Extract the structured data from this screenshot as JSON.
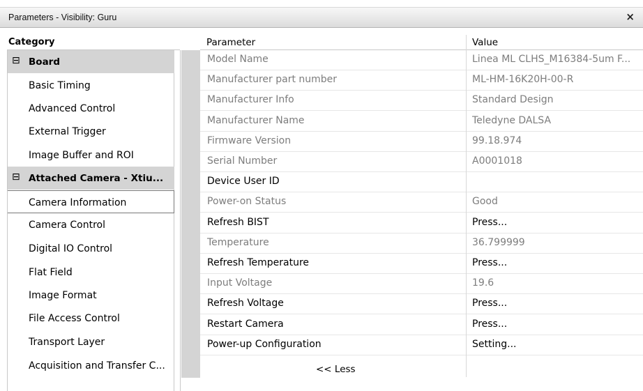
{
  "window": {
    "title": "Parameters - Visibility: Guru",
    "close_glyph": "×"
  },
  "headers": {
    "category": "Category",
    "parameter": "Parameter",
    "value": "Value"
  },
  "categories": [
    {
      "type": "group",
      "glyph": "⊟",
      "label": "Board"
    },
    {
      "type": "item",
      "label": "Basic Timing"
    },
    {
      "type": "item",
      "label": "Advanced Control"
    },
    {
      "type": "item",
      "label": "External Trigger"
    },
    {
      "type": "item",
      "label": "Image Buffer and ROI"
    },
    {
      "type": "group",
      "glyph": "⊟",
      "label": "Attached Camera - Xtiu..."
    },
    {
      "type": "item",
      "label": "Camera Information",
      "selected": true
    },
    {
      "type": "item",
      "label": "Camera Control"
    },
    {
      "type": "item",
      "label": "Digital IO Control"
    },
    {
      "type": "item",
      "label": "Flat Field"
    },
    {
      "type": "item",
      "label": "Image Format"
    },
    {
      "type": "item",
      "label": "File Access Control"
    },
    {
      "type": "item",
      "label": "Transport Layer"
    },
    {
      "type": "item",
      "label": "Acquisition and Transfer C..."
    }
  ],
  "parameters": [
    {
      "name": "Model Name",
      "value": "Linea ML CLHS_M16384-5um F...",
      "readonly": true
    },
    {
      "name": "Manufacturer part number",
      "value": "ML-HM-16K20H-00-R",
      "readonly": true
    },
    {
      "name": "Manufacturer Info",
      "value": "Standard Design",
      "readonly": true
    },
    {
      "name": "Manufacturer Name",
      "value": "Teledyne DALSA",
      "readonly": true
    },
    {
      "name": "Firmware Version",
      "value": "99.18.974",
      "readonly": true
    },
    {
      "name": "Serial Number",
      "value": "A0001018",
      "readonly": true
    },
    {
      "name": "Device User ID",
      "value": "",
      "readonly": false
    },
    {
      "name": "Power-on Status",
      "value": "Good",
      "readonly": true
    },
    {
      "name": "Refresh BIST",
      "value": "Press...",
      "readonly": false
    },
    {
      "name": "Temperature",
      "value": "36.799999",
      "readonly": true
    },
    {
      "name": "Refresh Temperature",
      "value": "Press...",
      "readonly": false
    },
    {
      "name": "Input Voltage",
      "value": "19.6",
      "readonly": true
    },
    {
      "name": "Refresh Voltage",
      "value": "Press...",
      "readonly": false
    },
    {
      "name": "Restart Camera",
      "value": "Press...",
      "readonly": false
    },
    {
      "name": "Power-up Configuration",
      "value": "Setting...",
      "readonly": false
    }
  ],
  "footer": {
    "less_label": "<< Less"
  }
}
